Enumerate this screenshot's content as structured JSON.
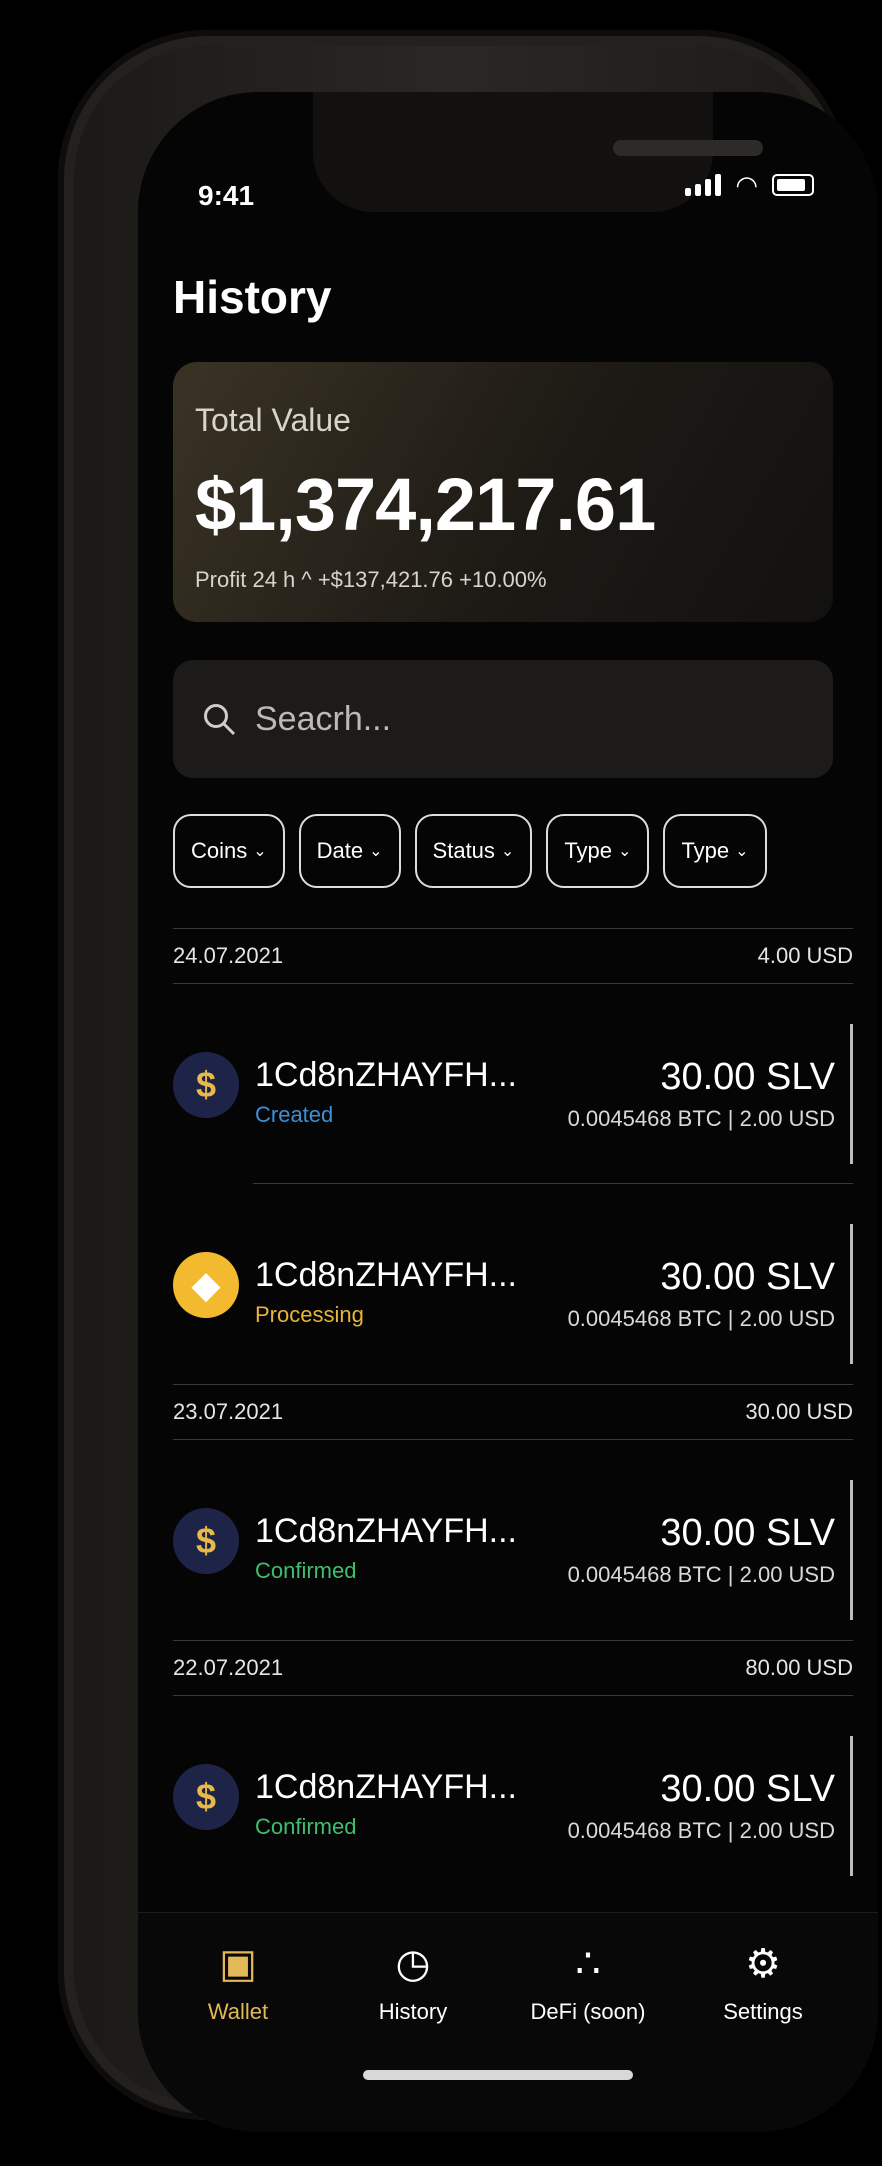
{
  "status_bar": {
    "time": "9:41"
  },
  "header": {
    "title": "History"
  },
  "total": {
    "label": "Total Value",
    "amount": "$1,374,217.61",
    "profit": "Profit 24 h  ^ +$137,421.76  +10.00%"
  },
  "search": {
    "placeholder": "Seacrh..."
  },
  "filters": [
    {
      "label": "Coins"
    },
    {
      "label": "Date"
    },
    {
      "label": "Status"
    },
    {
      "label": "Type"
    },
    {
      "label": "Type"
    }
  ],
  "groups": [
    {
      "date": "24.07.2021",
      "total": "4.00 USD",
      "items": [
        {
          "coin": "slv",
          "address": "1Cd8nZHAYFH...",
          "status": "Created",
          "amount": "30.00 SLV",
          "sub": "0.0045468 BTC | 2.00 USD"
        },
        {
          "coin": "bnb",
          "address": "1Cd8nZHAYFH...",
          "status": "Processing",
          "amount": "30.00 SLV",
          "sub": "0.0045468 BTC | 2.00 USD"
        }
      ]
    },
    {
      "date": "23.07.2021",
      "total": "30.00 USD",
      "items": [
        {
          "coin": "slv",
          "address": "1Cd8nZHAYFH...",
          "status": "Confirmed",
          "amount": "30.00 SLV",
          "sub": "0.0045468 BTC | 2.00 USD"
        }
      ]
    },
    {
      "date": "22.07.2021",
      "total": "80.00 USD",
      "items": [
        {
          "coin": "slv",
          "address": "1Cd8nZHAYFH...",
          "status": "Confirmed",
          "amount": "30.00 SLV",
          "sub": "0.0045468 BTC | 2.00 USD"
        }
      ]
    }
  ],
  "tabbar": [
    {
      "label": "Wallet",
      "icon": "wallet-icon",
      "active": true
    },
    {
      "label": "History",
      "icon": "history-icon",
      "active": false
    },
    {
      "label": "DeFi (soon)",
      "icon": "defi-icon",
      "active": false
    },
    {
      "label": "Settings",
      "icon": "settings-icon",
      "active": false
    }
  ],
  "colors": {
    "accent": "#e3b857",
    "created": "#3c8fd8",
    "processing": "#e7b534",
    "confirmed": "#3fbf6e"
  }
}
